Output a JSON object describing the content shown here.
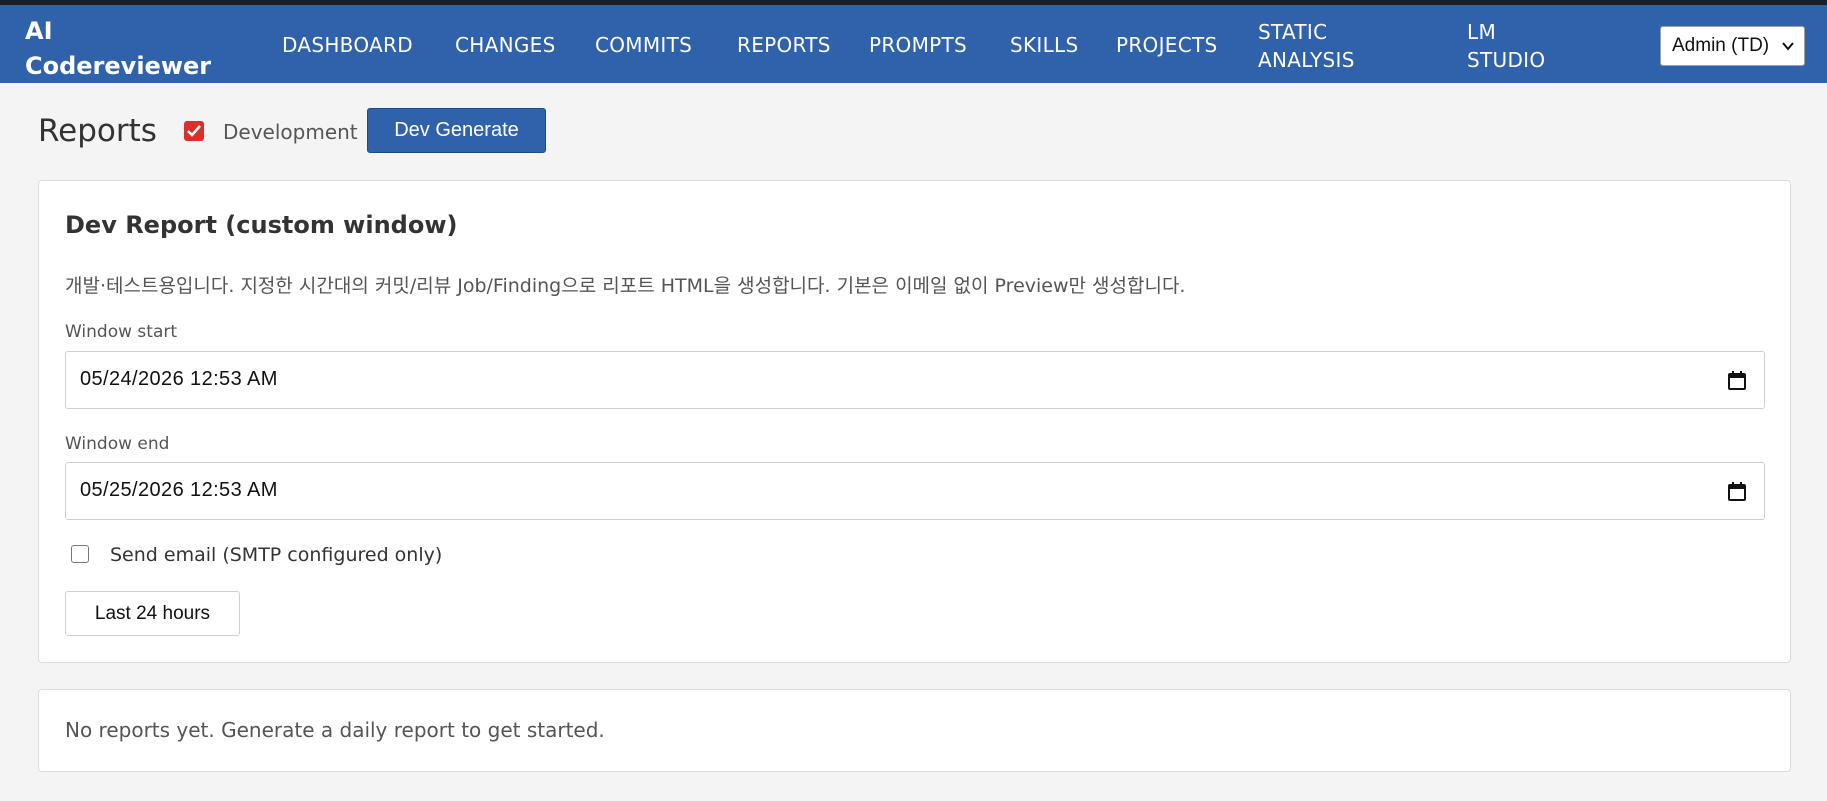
{
  "app": {
    "brand_line1": "AI",
    "brand_line2": "Codereviewer"
  },
  "nav": {
    "items": [
      {
        "label": "DASHBOARD"
      },
      {
        "label": "CHANGES"
      },
      {
        "label": "COMMITS"
      },
      {
        "label": "REPORTS"
      },
      {
        "label": "PROMPTS"
      },
      {
        "label": "SKILLS"
      },
      {
        "label": "PROJECTS"
      },
      {
        "label_line1": "STATIC",
        "label_line2": "ANALYSIS"
      },
      {
        "label_line1": "LM",
        "label_line2": "STUDIO"
      }
    ],
    "user_select": "Admin (TD)"
  },
  "page": {
    "title": "Reports",
    "dev_checkbox_label": "Development",
    "dev_checked": true,
    "dev_generate_label": "Dev Generate"
  },
  "dev_report": {
    "title": "Dev Report (custom window)",
    "description": "개발·테스트용입니다. 지정한 시간대의 커밋/리뷰 Job/Finding으로 리포트 HTML을 생성합니다. 기본은 이메일 없이 Preview만 생성합니다.",
    "window_start_label": "Window start",
    "window_start_value": "05/24/2026  12:53  AM",
    "window_end_label": "Window end",
    "window_end_value": "05/25/2026  12:53  AM",
    "send_email_label": "Send email (SMTP configured only)",
    "send_email_checked": false,
    "last24_label": "Last 24 hours"
  },
  "reports": {
    "empty_message": "No reports yet. Generate a daily report to get started."
  },
  "colors": {
    "navbar": "#2f62ab",
    "accent_check": "#d9302c",
    "page_bg": "#f4f4f4"
  },
  "icons": {
    "dev_check": "checkmark-icon",
    "calendar": "calendar-icon",
    "select_arrow": "chevron-down-icon"
  }
}
